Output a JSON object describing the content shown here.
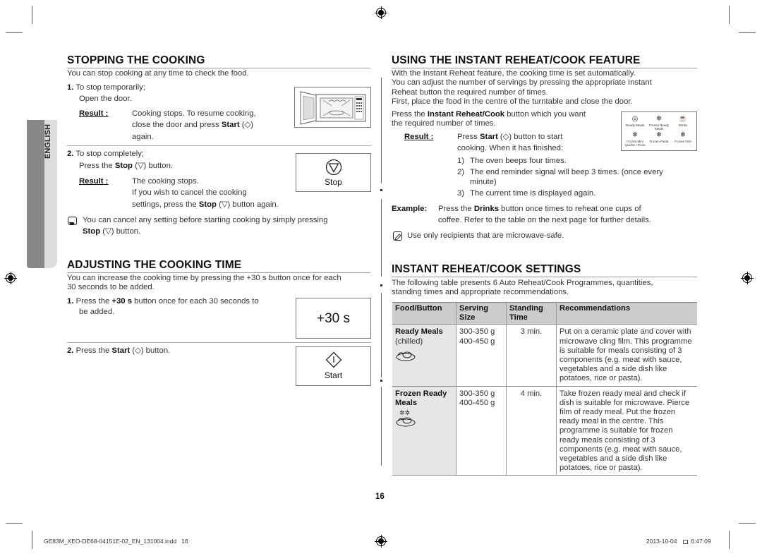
{
  "page": {
    "page_number": "16",
    "side_tab_label": "ENGLISH",
    "footer_file": "GE83M_XEO-DE68-04151E-02_EN_131004.indd   16",
    "footer_date": "2013-10-04",
    "footer_time": "6:47:09"
  },
  "left": {
    "stopping": {
      "title": "STOPPING THE COOKING",
      "intro": "You can stop cooking at any time to check the food.",
      "step1_num": "1.",
      "step1_line1": "To stop temporarily;",
      "step1_line2": "Open the door.",
      "result_label": "Result :",
      "step1_result_line1": "Cooking stops. To resume cooking,",
      "step1_result_line2a": "close the door and press ",
      "step1_result_line2b": "Start",
      "step1_result_line2c": " (◇)",
      "step1_result_line3": "again.",
      "step2_num": "2.",
      "step2_line1": "To stop completely;",
      "step2_line2a": "Press the ",
      "step2_line2b": "Stop",
      "step2_line2c": " (▽) button.",
      "step2_result_line1": "The cooking stops.",
      "step2_result_line2": "If you wish to cancel the cooking",
      "step2_result_line3a": "settings, press the ",
      "step2_result_line3b": "Stop",
      "step2_result_line3c": " (▽) button again.",
      "stop_button_label": "Stop",
      "note_line1": "You can cancel any setting before starting cooking by simply pressing",
      "note_line2a": "Stop",
      "note_line2b": " (▽) button."
    },
    "adjusting": {
      "title": "ADJUSTING THE COOKING TIME",
      "intro_line1": "You can increase the cooking time by pressing the +30 s button once for each",
      "intro_line2": "30 seconds to be added.",
      "step1_num": "1.",
      "step1_a": "Press the ",
      "step1_b": "+30 s",
      "step1_c": " button once for each 30 seconds to",
      "step1_line2": "be added.",
      "plus30_label": "+30 s",
      "step2_num": "2.",
      "step2_a": "Press the ",
      "step2_b": "Start",
      "step2_c": " (◇) button.",
      "start_button_label": "Start"
    }
  },
  "right": {
    "using": {
      "title": "USING THE INSTANT REHEAT/COOK FEATURE",
      "p1": "With the Instant Reheat feature, the cooking time is set automatically.",
      "p2": "You can adjust the number of servings by pressing the appropriate Instant",
      "p3": "Reheat button the required number of times.",
      "p4": "First, place the food in the centre of the turntable and close the door.",
      "press_a": "Press the ",
      "press_b": "Instant Reheat/Cook",
      "press_c": " button which you want",
      "press_line2": "the required number of times.",
      "result_label": "Result :",
      "result_line1a": "Press ",
      "result_line1b": "Start",
      "result_line1c": " (◇) button to start",
      "result_line2": "cooking. When it has finished:",
      "list": [
        {
          "n": "1)",
          "text": "The oven beeps four times."
        },
        {
          "n": "2)",
          "text": "The end reminder signal will beep 3 times. (once every"
        },
        {
          "n": "",
          "text": "minute)"
        },
        {
          "n": "3)",
          "text": "The current time is displayed again."
        }
      ],
      "example_label": "Example:",
      "example_a": "Press the ",
      "example_b": "Drinks",
      "example_c": " button once times to reheat one cups of",
      "example_line2": "coffee. Refer to the table on the next page for further details.",
      "note": "Use only recipients that are microwave-safe.",
      "panel_buttons": [
        "Ready Meals",
        "Frozen Ready Meals",
        "Drinks",
        "Frozen Mini Quiche / Pizza",
        "Frozen Pasta",
        "Frozen Fish"
      ]
    },
    "settings": {
      "title": "INSTANT REHEAT/COOK SETTINGS",
      "intro_line1": "The following table presents 6 Auto Reheat/Cook Programmes, quantities,",
      "intro_line2": "standing times and appropriate recommendations.",
      "headers": [
        "Food/Button",
        "Serving Size",
        "Standing Time",
        "Recommendations"
      ],
      "rows": [
        {
          "food": "Ready Meals",
          "food_sub": "(chilled)",
          "icon": "ready-meal-icon",
          "sizes": [
            "300-350 g",
            "400-450 g"
          ],
          "standing": "3 min.",
          "recommendation": "Put on a ceramic plate and cover with microwave cling film. This programme is suitable for meals consisting of 3 components (e.g. meat with sauce, vegetables and a side dish like potatoes, rice or pasta)."
        },
        {
          "food": "Frozen Ready Meals",
          "food_sub": "",
          "icon": "frozen-ready-meal-icon",
          "sizes": [
            "300-350 g",
            "400-450 g"
          ],
          "standing": "4 min.",
          "recommendation": "Take frozen ready meal and check if dish is suitable for microwave. Pierce film of ready meal. Put the frozen ready meal in the centre. This programme is suitable for frozen ready meals consisting of 3 components (e.g. meat with sauce, vegetables and a side dish like potatoes, rice or pasta)."
        }
      ]
    }
  }
}
